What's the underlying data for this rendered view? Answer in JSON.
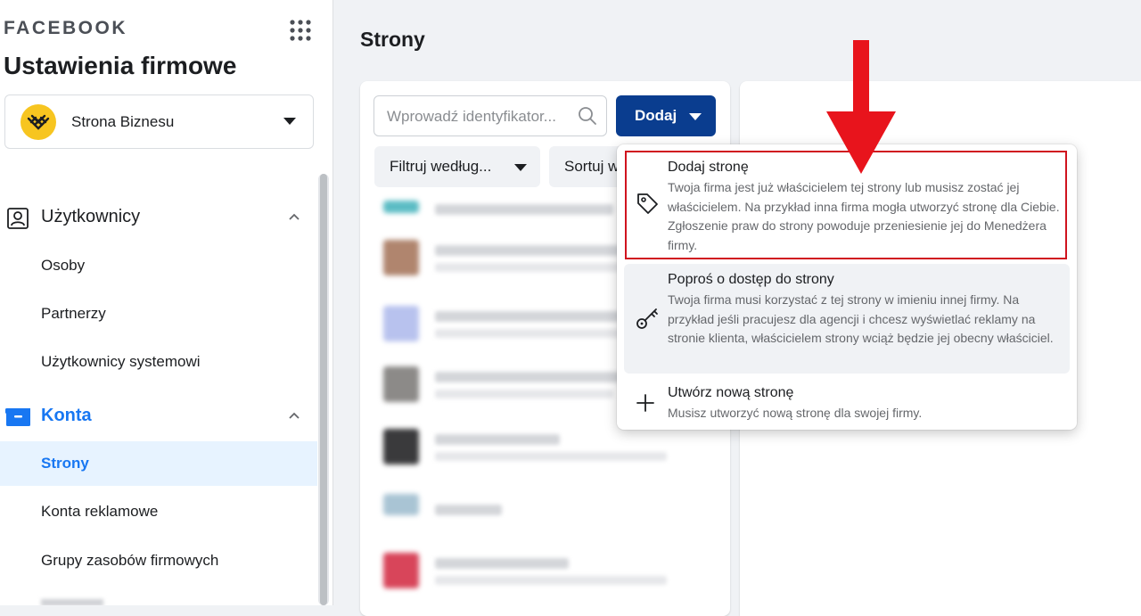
{
  "sidebar": {
    "brand": "FACEBOOK",
    "title": "Ustawienia firmowe",
    "business_selector": {
      "name": "Strona Biznesu"
    },
    "sections": [
      {
        "label": "Użytkownicy",
        "icon": "users-id-icon",
        "items": [
          {
            "label": "Osoby"
          },
          {
            "label": "Partnerzy"
          },
          {
            "label": "Użytkownicy systemowi"
          }
        ]
      },
      {
        "label": "Konta",
        "icon": "briefcase-icon",
        "items": [
          {
            "label": "Strony",
            "active": true
          },
          {
            "label": "Konta reklamowe"
          },
          {
            "label": "Grupy zasobów firmowych"
          }
        ]
      }
    ]
  },
  "main": {
    "title": "Strony",
    "search": {
      "placeholder": "Wprowadź identyfikator..."
    },
    "add_button": "Dodaj",
    "filter_button": "Filtruj według...",
    "sort_button": "Sortuj według"
  },
  "dropdown": {
    "items": [
      {
        "title": "Dodaj stronę",
        "icon": "tag-icon",
        "description": "Twoja firma jest już właścicielem tej strony lub musisz zostać jej właścicielem. Na przykład inna firma mogła utworzyć stronę dla Ciebie. Zgłoszenie praw do strony powoduje przeniesienie jej do Menedżera firmy."
      },
      {
        "title": "Poproś o dostęp do strony",
        "icon": "key-icon",
        "description": "Twoja firma musi korzystać z tej strony w imieniu innej firmy. Na przykład jeśli pracujesz dla agencji i chcesz wyświetlać reklamy na stronie klienta, właścicielem strony wciąż będzie jej obecny właściciel."
      },
      {
        "title": "Utwórz nową stronę",
        "icon": "plus-icon",
        "description": "Musisz utworzyć nową stronę dla swojej firmy."
      }
    ]
  },
  "colors": {
    "brand_blue": "#1877f2",
    "add_button_bg": "#0a3d8f",
    "annotation_red": "#e8141c"
  }
}
